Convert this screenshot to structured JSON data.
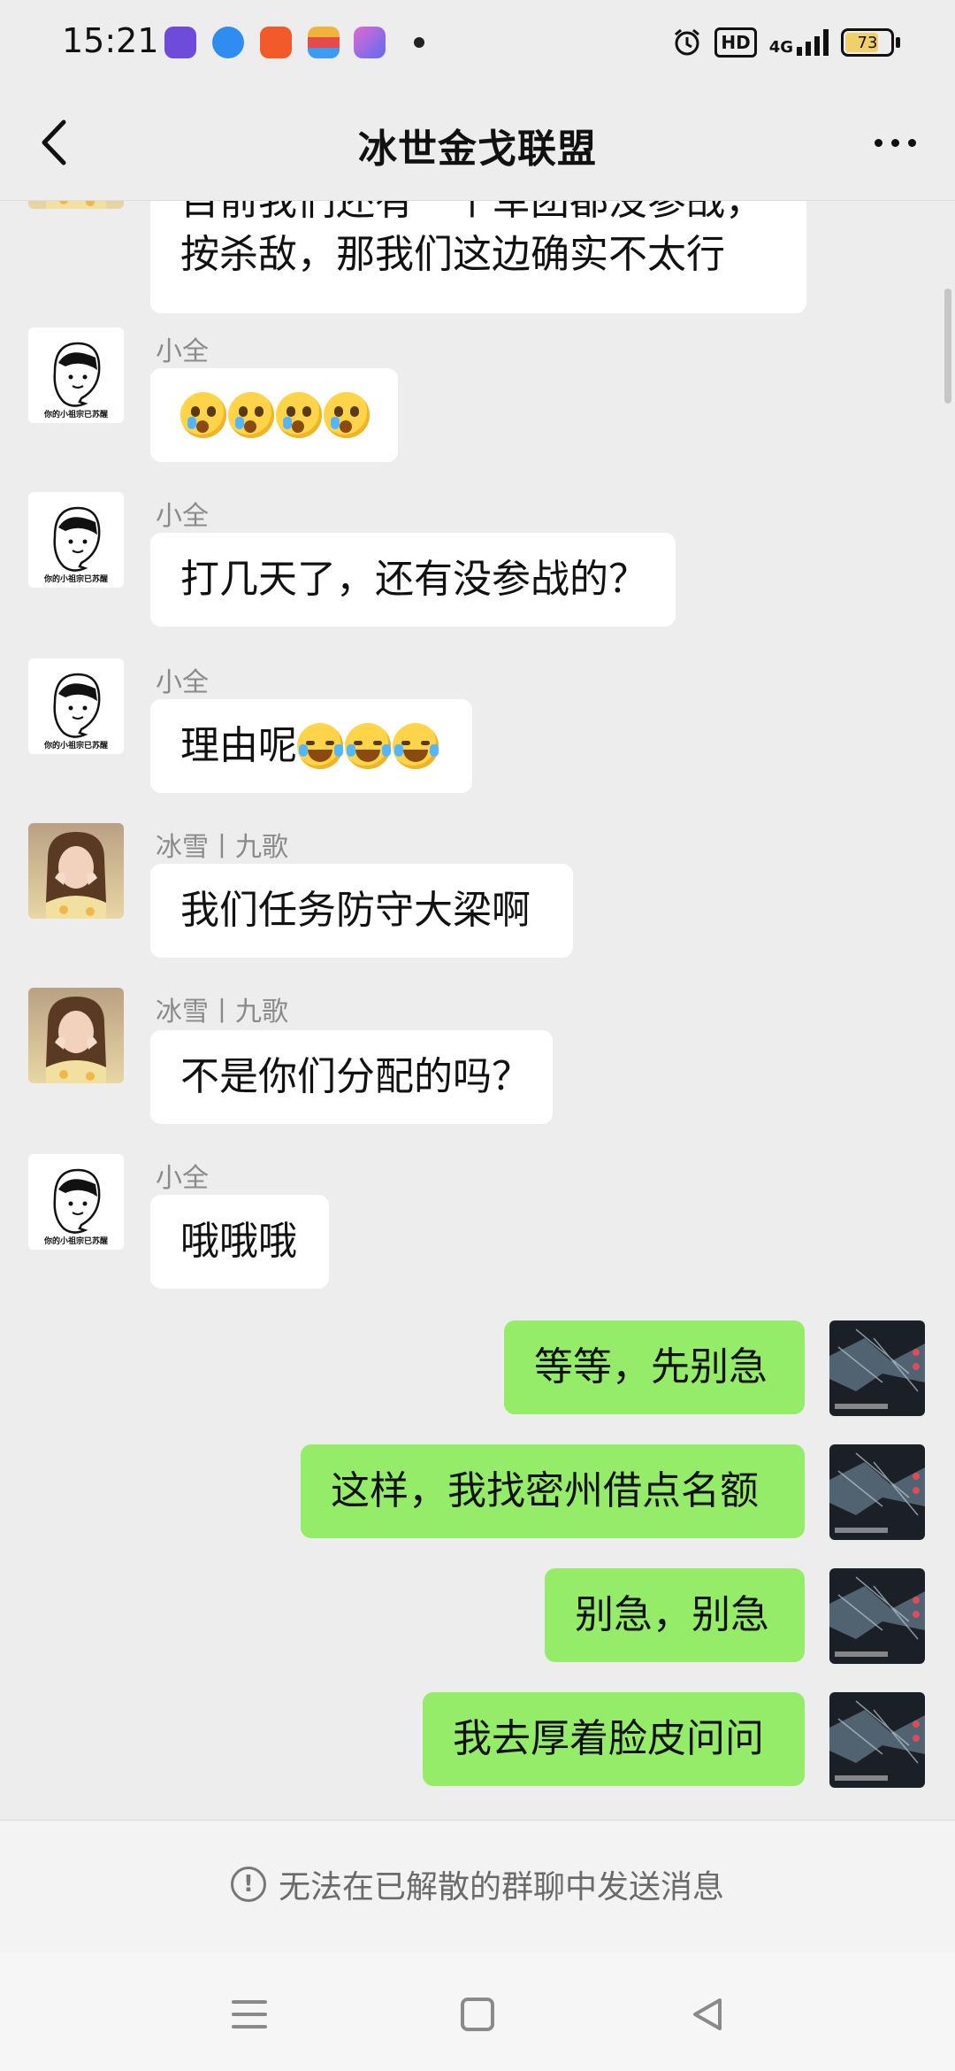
{
  "status_bar": {
    "time": "15:21",
    "network_type": "4G",
    "hd_label": "HD",
    "battery_level": 73,
    "battery_text": "73",
    "notification_icons": [
      "purple-app-icon",
      "blue-app-icon",
      "orange-app-icon",
      "wallet-app-icon",
      "shortcut-app-icon"
    ]
  },
  "header": {
    "title": "冰世金戈联盟",
    "back_icon": "chevron-left-icon",
    "more_icon": "more-dots-icon"
  },
  "messages": [
    {
      "sender": "",
      "side": "left",
      "avatar": "girl-photo",
      "text_line1": "目前我们还有一个军团都没参战，",
      "text_line2": "按杀敌，那我们这边确实不太行"
    },
    {
      "sender": "小全",
      "side": "left",
      "avatar": "cartoon-sketch",
      "text": "",
      "emoji": [
        "crying-emoji",
        "crying-emoji",
        "crying-emoji",
        "crying-emoji"
      ]
    },
    {
      "sender": "小全",
      "side": "left",
      "avatar": "cartoon-sketch",
      "text": "打几天了，还有没参战的？"
    },
    {
      "sender": "小全",
      "side": "left",
      "avatar": "cartoon-sketch",
      "text": "理由呢",
      "emoji": [
        "laugh-cry-emoji",
        "laugh-cry-emoji",
        "laugh-cry-emoji"
      ]
    },
    {
      "sender": "冰雪丨九歌",
      "side": "left",
      "avatar": "girl-photo",
      "text": "我们任务防守大梁啊"
    },
    {
      "sender": "冰雪丨九歌",
      "side": "left",
      "avatar": "girl-photo",
      "text": "不是你们分配的吗？"
    },
    {
      "sender": "小全",
      "side": "left",
      "avatar": "cartoon-sketch",
      "text": "哦哦哦"
    },
    {
      "sender": "",
      "side": "right",
      "avatar": "dark-screenshot",
      "text": "等等，先别急"
    },
    {
      "sender": "",
      "side": "right",
      "avatar": "dark-screenshot",
      "text": "这样，我找密州借点名额"
    },
    {
      "sender": "",
      "side": "right",
      "avatar": "dark-screenshot",
      "text": "别急，别急"
    },
    {
      "sender": "",
      "side": "right",
      "avatar": "dark-screenshot",
      "text": "我去厚着脸皮问问"
    }
  ],
  "avatar_caption": "你的小祖宗已苏醒",
  "footer": {
    "notice_icon": "exclamation-icon",
    "notice_text": "无法在已解散的群聊中发送消息"
  },
  "nav": {
    "icons": [
      "menu-icon",
      "home-square-icon",
      "back-triangle-icon"
    ]
  },
  "colors": {
    "background": "#ededed",
    "my_bubble": "#95ec69",
    "their_bubble": "#ffffff"
  }
}
